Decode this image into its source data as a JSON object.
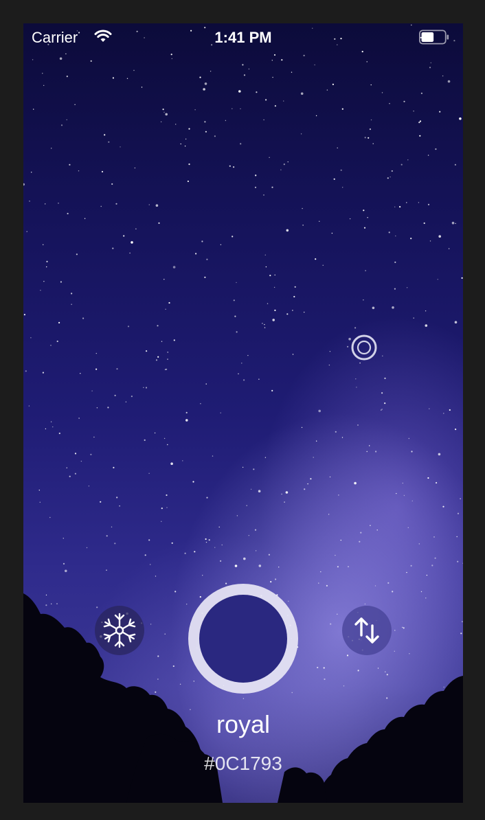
{
  "status_bar": {
    "carrier": "Carrier",
    "time": "1:41 PM",
    "wifi_icon": "wifi-icon",
    "battery_icon": "battery-icon"
  },
  "picker": {
    "target_icon": "target-reticle-icon",
    "freeze_icon": "snowflake-icon",
    "swap_icon": "swap-arrows-icon"
  },
  "color": {
    "name": "royal",
    "hex": "#0C1793",
    "swatch_color": "#2a2880"
  },
  "theme": {
    "background_frame": "#1c1c1c",
    "text_color": "#ffffff"
  }
}
